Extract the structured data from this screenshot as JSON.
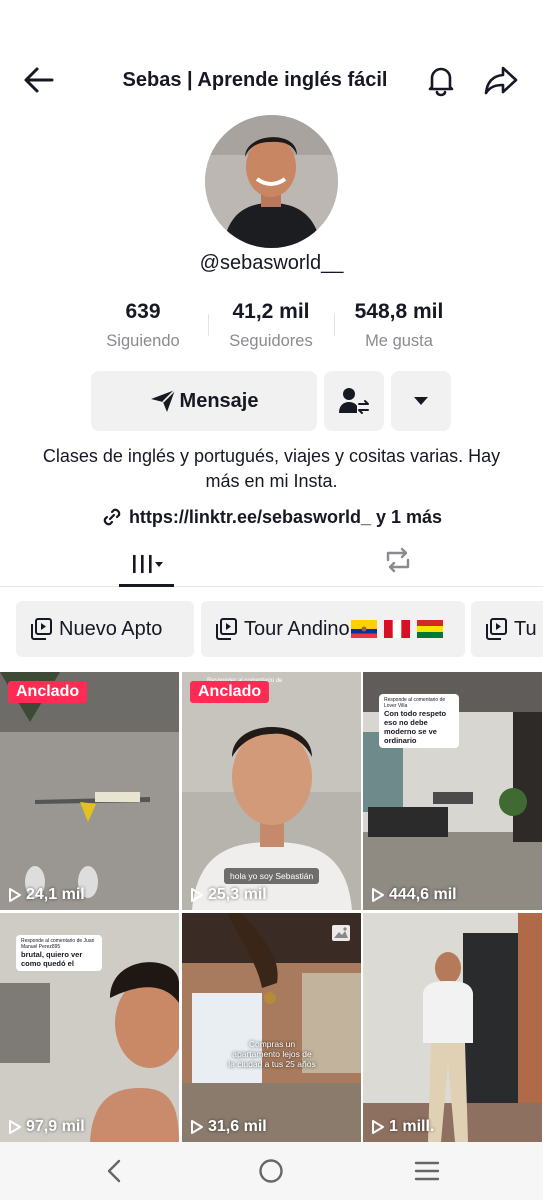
{
  "header": {
    "title": "Sebas | Aprende inglés fácil",
    "back_icon": "arrow-left-icon",
    "bell_icon": "bell-icon",
    "share_icon": "share-arrow-icon"
  },
  "profile": {
    "username": "@sebasworld__",
    "stats": [
      {
        "value": "639",
        "label": "Siguiendo"
      },
      {
        "value": "41,2 mil",
        "label": "Seguidores"
      },
      {
        "value": "548,8 mil",
        "label": "Me gusta"
      }
    ],
    "message_label": "Mensaje",
    "bio": "Clases de inglés y portugués, viajes y cositas varias. Hay más en mi Insta.",
    "link": "https://linktr.ee/sebasworld_ y 1 más"
  },
  "playlists": [
    {
      "label": "Nuevo Apto"
    },
    {
      "label": "Tour Andino"
    },
    {
      "label": "Tu"
    }
  ],
  "videos": [
    {
      "views": "24,1 mil",
      "pinned": "Anclado"
    },
    {
      "views": "25,3 mil",
      "pinned": "Anclado",
      "top_text": "Responder al comentario de",
      "caption": "hola yo soy Sebastián"
    },
    {
      "views": "444,6 mil",
      "comment_header": "Responde al comentario de Lover Villa",
      "comment": "Con todo respeto eso no debe moderno se ve ordinario"
    },
    {
      "views": "97,9 mil",
      "comment_header": "Responde al comentario de Juan Manuel Perez895",
      "comment": "brutal, quiero ver como quedó el"
    },
    {
      "views": "31,6 mil",
      "caption": "Compras un apartamento lejos de la ciudad a tus 25 años"
    },
    {
      "views": "1 mill."
    }
  ],
  "colors": {
    "accent": "#fe2c55",
    "text": "#161823",
    "muted": "#8a8b91",
    "button_bg": "#f1f1f2"
  }
}
